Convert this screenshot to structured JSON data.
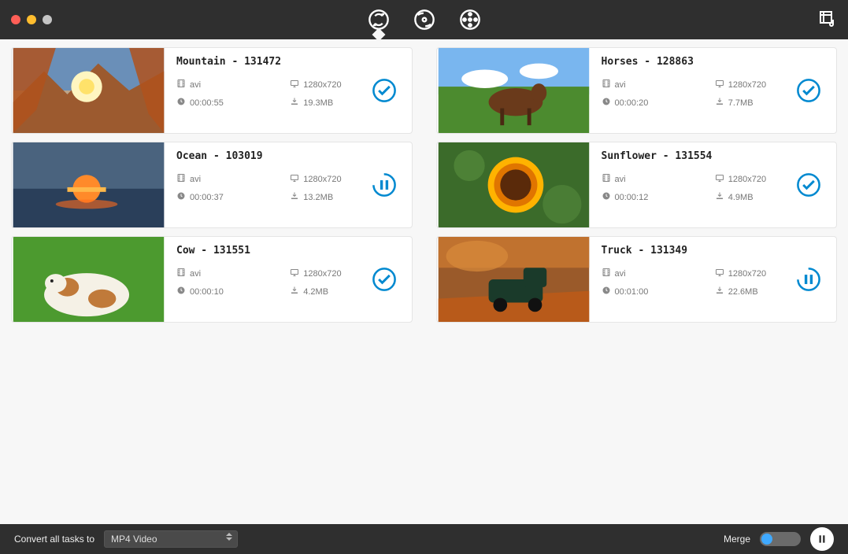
{
  "header": {
    "tabs": [
      "convert",
      "disc",
      "dvd"
    ],
    "active_tab": 0
  },
  "items": [
    {
      "title": "Mountain - 131472",
      "format": "avi",
      "resolution": "1280x720",
      "duration": "00:00:55",
      "size": "19.3MB",
      "status": "done",
      "thumb": "mountain"
    },
    {
      "title": "Horses - 128863",
      "format": "avi",
      "resolution": "1280x720",
      "duration": "00:00:20",
      "size": "7.7MB",
      "status": "done",
      "thumb": "horses"
    },
    {
      "title": "Ocean - 103019",
      "format": "avi",
      "resolution": "1280x720",
      "duration": "00:00:37",
      "size": "13.2MB",
      "status": "progress",
      "thumb": "ocean"
    },
    {
      "title": "Sunflower - 131554",
      "format": "avi",
      "resolution": "1280x720",
      "duration": "00:00:12",
      "size": "4.9MB",
      "status": "done",
      "thumb": "sunflower"
    },
    {
      "title": "Cow - 131551",
      "format": "avi",
      "resolution": "1280x720",
      "duration": "00:00:10",
      "size": "4.2MB",
      "status": "done",
      "thumb": "cow"
    },
    {
      "title": "Truck - 131349",
      "format": "avi",
      "resolution": "1280x720",
      "duration": "00:01:00",
      "size": "22.6MB",
      "status": "progress",
      "thumb": "truck"
    }
  ],
  "footer": {
    "convert_label": "Convert all tasks to",
    "format_selected": "MP4 Video",
    "merge_label": "Merge",
    "merge_on": false
  },
  "accent": "#0089d0"
}
